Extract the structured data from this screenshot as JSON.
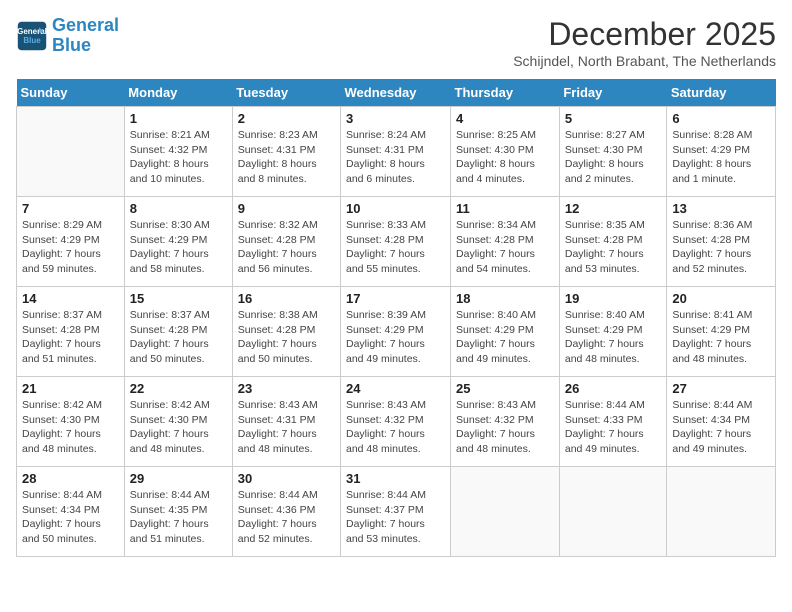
{
  "header": {
    "logo_line1": "General",
    "logo_line2": "Blue",
    "month": "December 2025",
    "location": "Schijndel, North Brabant, The Netherlands"
  },
  "weekdays": [
    "Sunday",
    "Monday",
    "Tuesday",
    "Wednesday",
    "Thursday",
    "Friday",
    "Saturday"
  ],
  "weeks": [
    [
      {
        "day": "",
        "info": ""
      },
      {
        "day": "1",
        "info": "Sunrise: 8:21 AM\nSunset: 4:32 PM\nDaylight: 8 hours and 10 minutes."
      },
      {
        "day": "2",
        "info": "Sunrise: 8:23 AM\nSunset: 4:31 PM\nDaylight: 8 hours and 8 minutes."
      },
      {
        "day": "3",
        "info": "Sunrise: 8:24 AM\nSunset: 4:31 PM\nDaylight: 8 hours and 6 minutes."
      },
      {
        "day": "4",
        "info": "Sunrise: 8:25 AM\nSunset: 4:30 PM\nDaylight: 8 hours and 4 minutes."
      },
      {
        "day": "5",
        "info": "Sunrise: 8:27 AM\nSunset: 4:30 PM\nDaylight: 8 hours and 2 minutes."
      },
      {
        "day": "6",
        "info": "Sunrise: 8:28 AM\nSunset: 4:29 PM\nDaylight: 8 hours and 1 minute."
      }
    ],
    [
      {
        "day": "7",
        "info": "Sunrise: 8:29 AM\nSunset: 4:29 PM\nDaylight: 7 hours and 59 minutes."
      },
      {
        "day": "8",
        "info": "Sunrise: 8:30 AM\nSunset: 4:29 PM\nDaylight: 7 hours and 58 minutes."
      },
      {
        "day": "9",
        "info": "Sunrise: 8:32 AM\nSunset: 4:28 PM\nDaylight: 7 hours and 56 minutes."
      },
      {
        "day": "10",
        "info": "Sunrise: 8:33 AM\nSunset: 4:28 PM\nDaylight: 7 hours and 55 minutes."
      },
      {
        "day": "11",
        "info": "Sunrise: 8:34 AM\nSunset: 4:28 PM\nDaylight: 7 hours and 54 minutes."
      },
      {
        "day": "12",
        "info": "Sunrise: 8:35 AM\nSunset: 4:28 PM\nDaylight: 7 hours and 53 minutes."
      },
      {
        "day": "13",
        "info": "Sunrise: 8:36 AM\nSunset: 4:28 PM\nDaylight: 7 hours and 52 minutes."
      }
    ],
    [
      {
        "day": "14",
        "info": "Sunrise: 8:37 AM\nSunset: 4:28 PM\nDaylight: 7 hours and 51 minutes."
      },
      {
        "day": "15",
        "info": "Sunrise: 8:37 AM\nSunset: 4:28 PM\nDaylight: 7 hours and 50 minutes."
      },
      {
        "day": "16",
        "info": "Sunrise: 8:38 AM\nSunset: 4:28 PM\nDaylight: 7 hours and 50 minutes."
      },
      {
        "day": "17",
        "info": "Sunrise: 8:39 AM\nSunset: 4:29 PM\nDaylight: 7 hours and 49 minutes."
      },
      {
        "day": "18",
        "info": "Sunrise: 8:40 AM\nSunset: 4:29 PM\nDaylight: 7 hours and 49 minutes."
      },
      {
        "day": "19",
        "info": "Sunrise: 8:40 AM\nSunset: 4:29 PM\nDaylight: 7 hours and 48 minutes."
      },
      {
        "day": "20",
        "info": "Sunrise: 8:41 AM\nSunset: 4:29 PM\nDaylight: 7 hours and 48 minutes."
      }
    ],
    [
      {
        "day": "21",
        "info": "Sunrise: 8:42 AM\nSunset: 4:30 PM\nDaylight: 7 hours and 48 minutes."
      },
      {
        "day": "22",
        "info": "Sunrise: 8:42 AM\nSunset: 4:30 PM\nDaylight: 7 hours and 48 minutes."
      },
      {
        "day": "23",
        "info": "Sunrise: 8:43 AM\nSunset: 4:31 PM\nDaylight: 7 hours and 48 minutes."
      },
      {
        "day": "24",
        "info": "Sunrise: 8:43 AM\nSunset: 4:32 PM\nDaylight: 7 hours and 48 minutes."
      },
      {
        "day": "25",
        "info": "Sunrise: 8:43 AM\nSunset: 4:32 PM\nDaylight: 7 hours and 48 minutes."
      },
      {
        "day": "26",
        "info": "Sunrise: 8:44 AM\nSunset: 4:33 PM\nDaylight: 7 hours and 49 minutes."
      },
      {
        "day": "27",
        "info": "Sunrise: 8:44 AM\nSunset: 4:34 PM\nDaylight: 7 hours and 49 minutes."
      }
    ],
    [
      {
        "day": "28",
        "info": "Sunrise: 8:44 AM\nSunset: 4:34 PM\nDaylight: 7 hours and 50 minutes."
      },
      {
        "day": "29",
        "info": "Sunrise: 8:44 AM\nSunset: 4:35 PM\nDaylight: 7 hours and 51 minutes."
      },
      {
        "day": "30",
        "info": "Sunrise: 8:44 AM\nSunset: 4:36 PM\nDaylight: 7 hours and 52 minutes."
      },
      {
        "day": "31",
        "info": "Sunrise: 8:44 AM\nSunset: 4:37 PM\nDaylight: 7 hours and 53 minutes."
      },
      {
        "day": "",
        "info": ""
      },
      {
        "day": "",
        "info": ""
      },
      {
        "day": "",
        "info": ""
      }
    ]
  ]
}
